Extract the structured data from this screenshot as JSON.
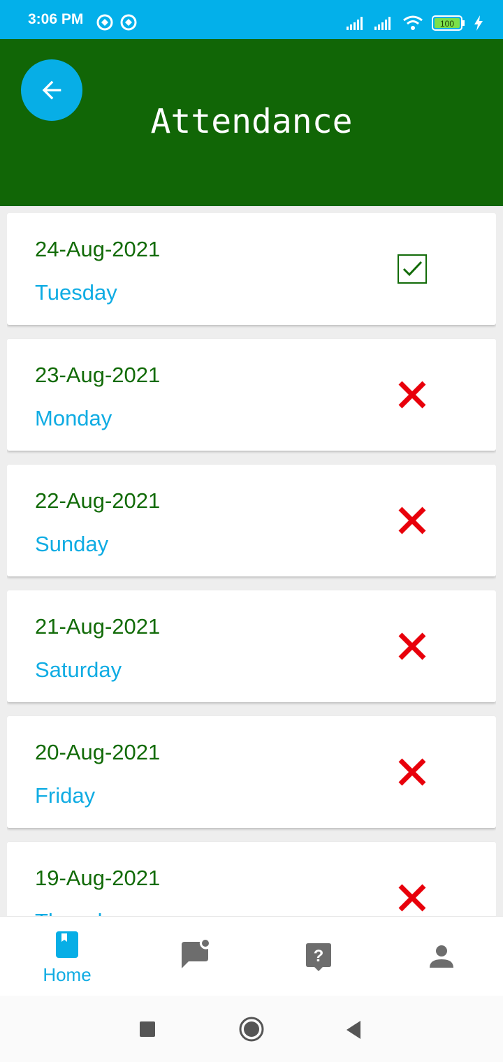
{
  "status_bar": {
    "time": "3:06 PM",
    "battery": "100",
    "icons": [
      "notification-icon",
      "notification-icon",
      "signal-icon",
      "signal-icon",
      "wifi-icon",
      "battery-icon",
      "charging-icon"
    ]
  },
  "header": {
    "title": "Attendance",
    "back_icon": "arrow-left-icon",
    "color": "#116606",
    "accent": "#07aee6"
  },
  "attendance": [
    {
      "date": "24-Aug-2021",
      "day": "Tuesday",
      "status": "present"
    },
    {
      "date": "23-Aug-2021",
      "day": "Monday",
      "status": "absent"
    },
    {
      "date": "22-Aug-2021",
      "day": "Sunday",
      "status": "absent"
    },
    {
      "date": "21-Aug-2021",
      "day": "Saturday",
      "status": "absent"
    },
    {
      "date": "20-Aug-2021",
      "day": "Friday",
      "status": "absent"
    },
    {
      "date": "19-Aug-2021",
      "day": "Thursday",
      "status": "absent"
    }
  ],
  "bottom_nav": {
    "items": [
      {
        "label": "Home",
        "icon": "book-icon",
        "active": true
      },
      {
        "label": "",
        "icon": "chat-icon",
        "active": false
      },
      {
        "label": "",
        "icon": "help-icon",
        "active": false
      },
      {
        "label": "",
        "icon": "profile-icon",
        "active": false
      }
    ]
  },
  "system_nav": {
    "icons": [
      "recents-icon",
      "home-icon",
      "back-icon"
    ]
  }
}
